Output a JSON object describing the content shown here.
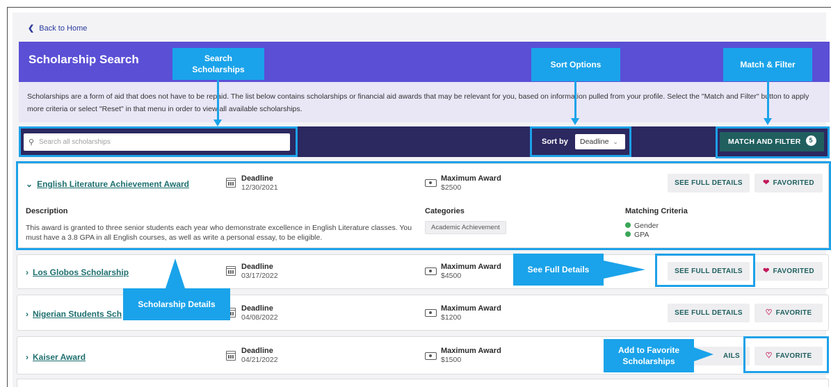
{
  "nav": {
    "back_label": "Back to Home"
  },
  "header": {
    "title": "Scholarship Search"
  },
  "info_text": "Scholarships are a form of aid that does not have to be repaid. The list below contains scholarships or financial aid awards that may be relevant for you, based on information pulled from your profile. Select the \"Match and Filter\" button to apply more criteria or select \"Reset\" in that menu in order to view all available scholarships.",
  "toolbar": {
    "search_placeholder": "Search all scholarships",
    "sort_label": "Sort by",
    "sort_value": "Deadline",
    "match_filter_label": "MATCH AND FILTER",
    "match_filter_count": "5"
  },
  "labels": {
    "deadline": "Deadline",
    "max_award": "Maximum Award",
    "see_full_details": "SEE FULL DETAILS",
    "description": "Description",
    "categories": "Categories",
    "matching_criteria": "Matching Criteria"
  },
  "scholarships": [
    {
      "name": "English Literature Achievement Award",
      "deadline": "12/30/2021",
      "max_award": "$2500",
      "favorite_label": "FAVORITED",
      "description": "This award is granted to three senior students each year who demonstrate excellence in English Literature classes. You must have a 3.8 GPA in all English courses, as well as write a personal essay, to be eligible.",
      "category": "Academic Achievement",
      "criteria": [
        "Gender",
        "GPA"
      ]
    },
    {
      "name": "Los Globos Scholarship",
      "deadline": "03/17/2022",
      "max_award": "$4500",
      "favorite_label": "FAVORITED"
    },
    {
      "name": "Nigerian Students Sch",
      "deadline": "04/08/2022",
      "max_award": "$1200",
      "favorite_label": "FAVORITE"
    },
    {
      "name": "Kaiser Award",
      "deadline": "04/21/2022",
      "max_award": "$1500",
      "favorite_label": "FAVORITE",
      "details_partial": "AILS"
    }
  ],
  "callouts": {
    "search": "Search Scholarships",
    "sort": "Sort Options",
    "match": "Match & Filter",
    "details": "Scholarship Details",
    "full_details": "See Full Details",
    "favorite": "Add to Favorite Scholarships"
  },
  "colors": {
    "header_bg": "#5b4fd6",
    "toolbar_bg": "#2c2860",
    "accent_teal": "#215f5f",
    "callout_blue": "#1aa3ea",
    "heart": "#c2185b"
  }
}
